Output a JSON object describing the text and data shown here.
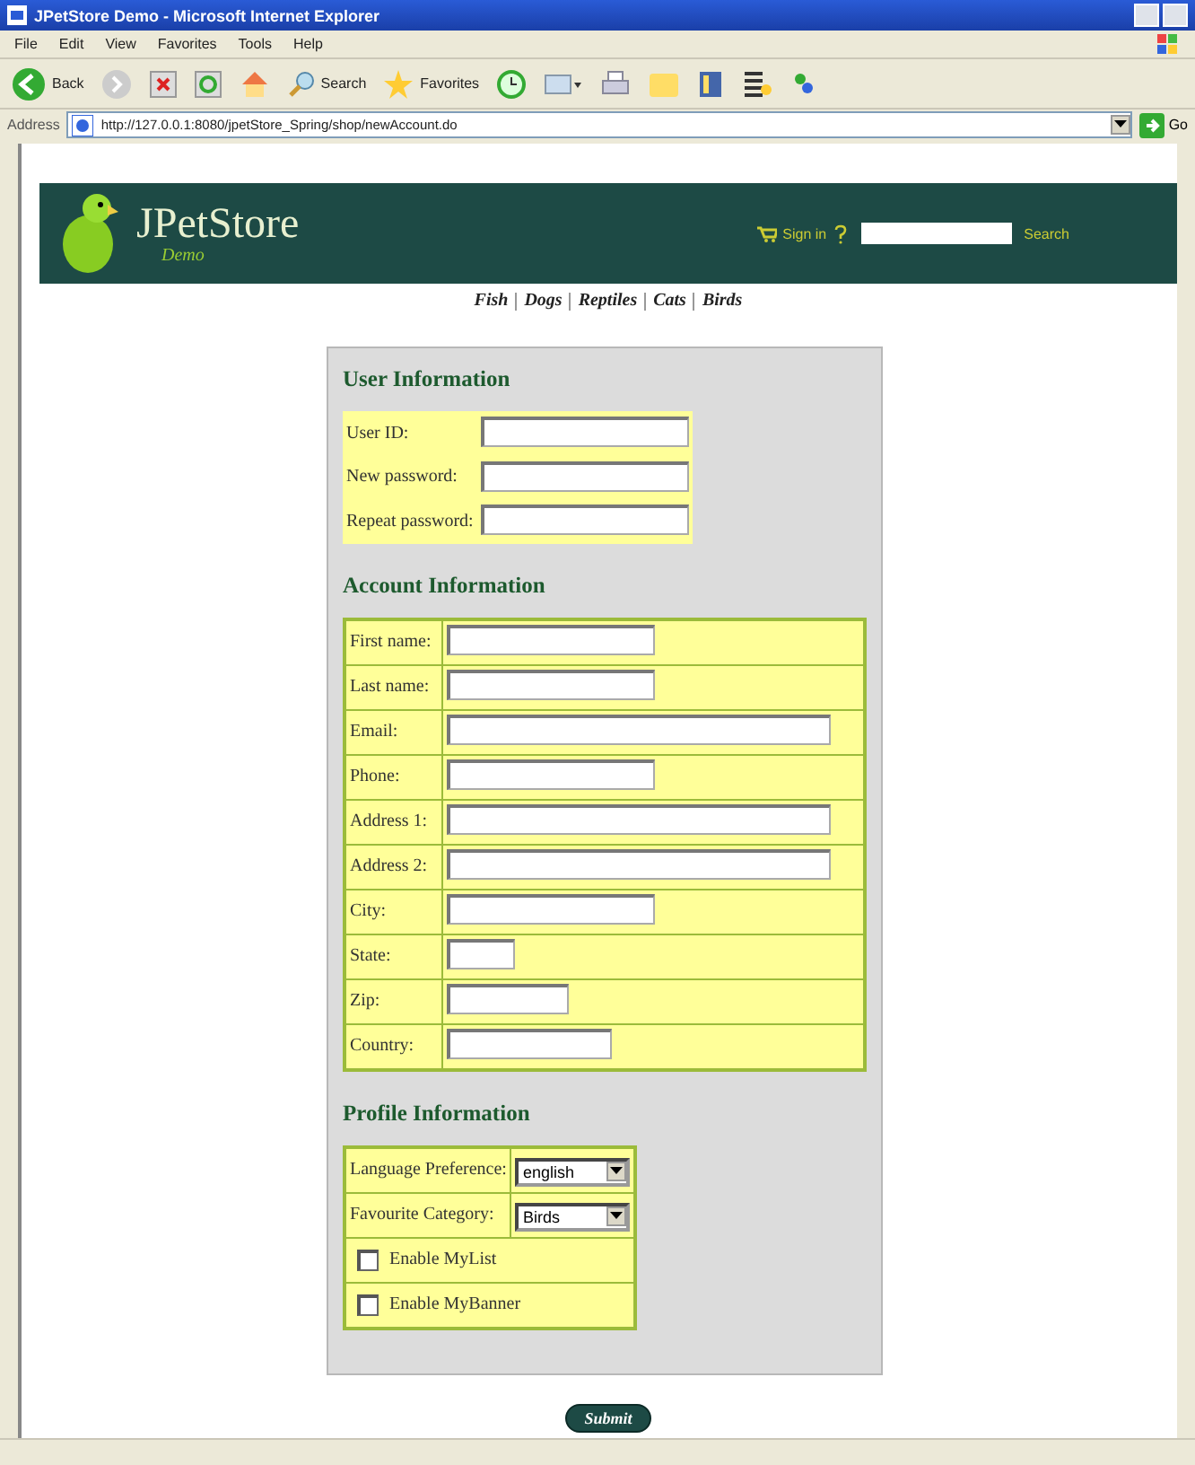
{
  "window": {
    "title": "JPetStore Demo - Microsoft Internet Explorer"
  },
  "menu": [
    "File",
    "Edit",
    "View",
    "Favorites",
    "Tools",
    "Help"
  ],
  "toolbar": {
    "back": "Back",
    "search": "Search",
    "favorites": "Favorites"
  },
  "address": {
    "label": "Address",
    "url": "http://127.0.0.1:8080/jpetStore_Spring/shop/newAccount.do",
    "go": "Go"
  },
  "header": {
    "logo": "JPetStore",
    "tagline": "Demo",
    "signin": "Sign in",
    "search_button": "Search"
  },
  "nav": [
    "Fish",
    "Dogs",
    "Reptiles",
    "Cats",
    "Birds"
  ],
  "user_info": {
    "title": "User Information",
    "fields": [
      {
        "label": "User ID:"
      },
      {
        "label": "New password:"
      },
      {
        "label": "Repeat password:"
      }
    ]
  },
  "account_info": {
    "title": "Account Information",
    "fields": [
      {
        "label": "First name:"
      },
      {
        "label": "Last name:"
      },
      {
        "label": "Email:"
      },
      {
        "label": "Phone:"
      },
      {
        "label": "Address 1:"
      },
      {
        "label": "Address 2:"
      },
      {
        "label": "City:"
      },
      {
        "label": "State:"
      },
      {
        "label": "Zip:"
      },
      {
        "label": "Country:"
      }
    ]
  },
  "profile_info": {
    "title": "Profile Information",
    "selects": [
      {
        "label": "Language Preference:",
        "value": "english"
      },
      {
        "label": "Favourite Category:",
        "value": "Birds"
      }
    ],
    "checkboxes": [
      {
        "label": "Enable MyList",
        "checked": false
      },
      {
        "label": "Enable MyBanner",
        "checked": false
      }
    ]
  },
  "submit": "Submit"
}
